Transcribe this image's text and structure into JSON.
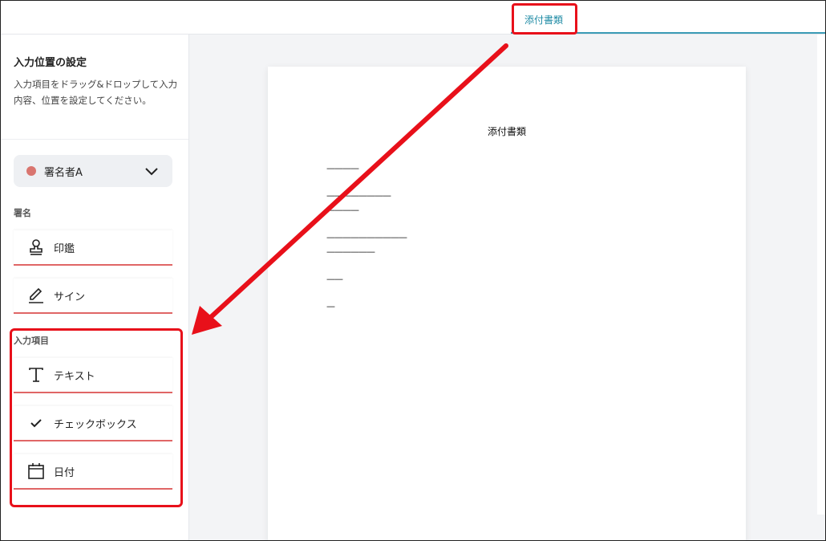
{
  "header": {
    "tab_label": "添付書類"
  },
  "sidebar": {
    "title": "入力位置の設定",
    "description": "入力項目をドラッグ&ドロップして入力内容、位置を設定してください。",
    "signer": {
      "label": "署名者A",
      "dot_color": "#d9756f"
    },
    "signature_section": {
      "label": "署名",
      "items": [
        {
          "label": "印鑑",
          "icon": "stamp-icon"
        },
        {
          "label": "サイン",
          "icon": "pen-icon"
        }
      ]
    },
    "input_section": {
      "label": "入力項目",
      "items": [
        {
          "label": "テキスト",
          "icon": "text-icon"
        },
        {
          "label": "チェックボックス",
          "icon": "checkmark-icon"
        },
        {
          "label": "日付",
          "icon": "calendar-icon"
        }
      ]
    }
  },
  "document": {
    "title": "添付書類",
    "lines": [
      "————",
      "————————",
      "————",
      "——————————",
      "——————",
      "——",
      "—"
    ]
  },
  "colors": {
    "accent": "#1f8ba5",
    "highlight": "#e8101a",
    "field_underline": "#e06666"
  }
}
